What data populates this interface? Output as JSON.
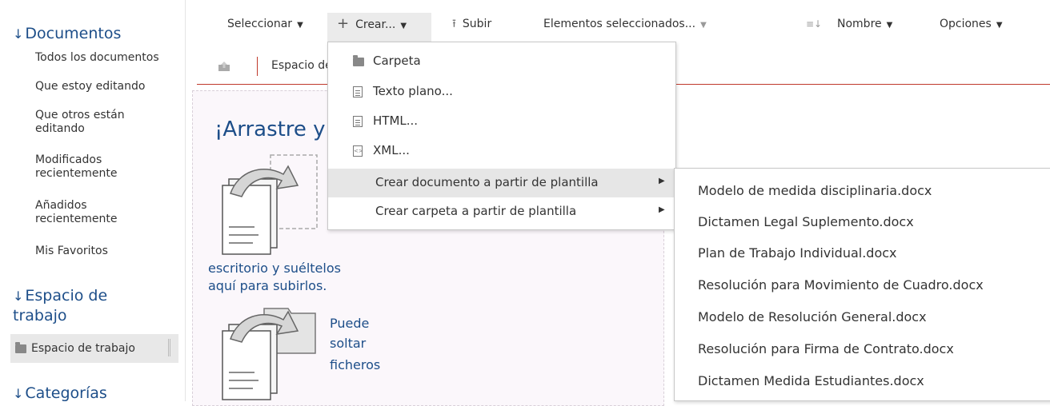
{
  "sidebar": {
    "documents_header": "Documentos",
    "documents_links": [
      "Todos los documentos",
      "Que estoy editando",
      "Que otros están editando",
      "Modificados recientemente",
      "Añadidos recientemente",
      "Mis Favoritos"
    ],
    "workspace_header": "Espacio de trabajo",
    "workspace_item": "Espacio de trabajo",
    "categories_header": "Categorías"
  },
  "toolbar": {
    "select": "Seleccionar",
    "create": "Crear...",
    "upload": "Subir",
    "selected_items": "Elementos seleccionados...",
    "sort": "Nombre",
    "options": "Opciones"
  },
  "path": {
    "text": "Espacio de trabajo"
  },
  "drop": {
    "title": "¡Arrastre y",
    "line1": "escritorio y suéltelos",
    "line2": "aquí para subirlos.",
    "small1": "Puede",
    "small2": "soltar",
    "small3": "ficheros"
  },
  "create_menu": {
    "items": [
      "Carpeta",
      "Texto plano...",
      "HTML...",
      "XML...",
      "Crear documento a partir de plantilla",
      "Crear carpeta a partir de plantilla"
    ]
  },
  "templates": [
    "Modelo de medida disciplinaria.docx",
    "Dictamen Legal Suplemento.docx",
    "Plan de Trabajo Individual.docx",
    "Resolución para Movimiento de Cuadro.docx",
    "Modelo de Resolución General.docx",
    "Resolución para Firma de Contrato.docx",
    "Dictamen Medida Estudiantes.docx"
  ],
  "colors": {
    "accent_blue": "#1d4e89",
    "accent_red": "#c0392b",
    "menu_highlight": "#e6e6e6"
  }
}
